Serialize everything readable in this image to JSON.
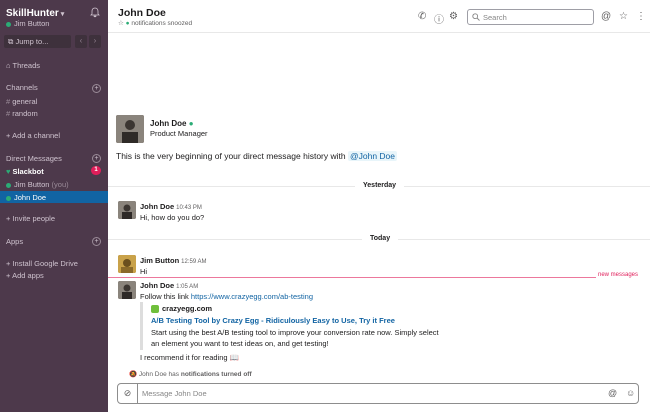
{
  "sidebar": {
    "workspace": "SkillHunter",
    "user": "Jim Button",
    "jump_to": "Jump to...",
    "threads": "Threads",
    "channels_header": "Channels",
    "channels": [
      "general",
      "random"
    ],
    "add_channel": "Add a channel",
    "dm_header": "Direct Messages",
    "dms": [
      {
        "name": "Slackbot",
        "badge": "1"
      },
      {
        "name": "Jim Button",
        "suffix": "(you)"
      },
      {
        "name": "John Doe",
        "active": true
      }
    ],
    "invite_people": "Invite people",
    "apps_header": "Apps",
    "apps": [
      "Install Google Drive",
      "Add apps"
    ]
  },
  "header": {
    "title": "John Doe",
    "subtitle": "notifications snoozed",
    "search_placeholder": "Search"
  },
  "intro": {
    "name": "John Doe",
    "role": "Product Manager",
    "text": "This is the very beginning of your direct message history with",
    "mention": "@John Doe"
  },
  "dividers": {
    "yesterday": "Yesterday",
    "today": "Today",
    "new_messages": "new messages"
  },
  "messages": [
    {
      "author": "John Doe",
      "time": "10:43 PM",
      "text": "Hi, how do you do?"
    },
    {
      "author": "Jim Button",
      "time": "12:59 AM",
      "text": "Hi"
    },
    {
      "author": "John Doe",
      "time": "1:05 AM",
      "text_prefix": "Follow this link",
      "link": "https://www.crazyegg.com/ab-testing",
      "followup": "I recommend it for reading 📖"
    }
  ],
  "unfurl": {
    "site": "crazyegg.com",
    "title": "A/B Testing Tool by Crazy Egg - Ridiculously Easy to Use, Try it Free",
    "description": "Start using the best A/B testing tool to improve your conversion rate now. Simply select an element you want to test ideas on, and get testing!"
  },
  "notice": {
    "name": "John Doe",
    "text": "has",
    "bold": "notifications turned off"
  },
  "composer": {
    "placeholder": "Message John Doe"
  }
}
